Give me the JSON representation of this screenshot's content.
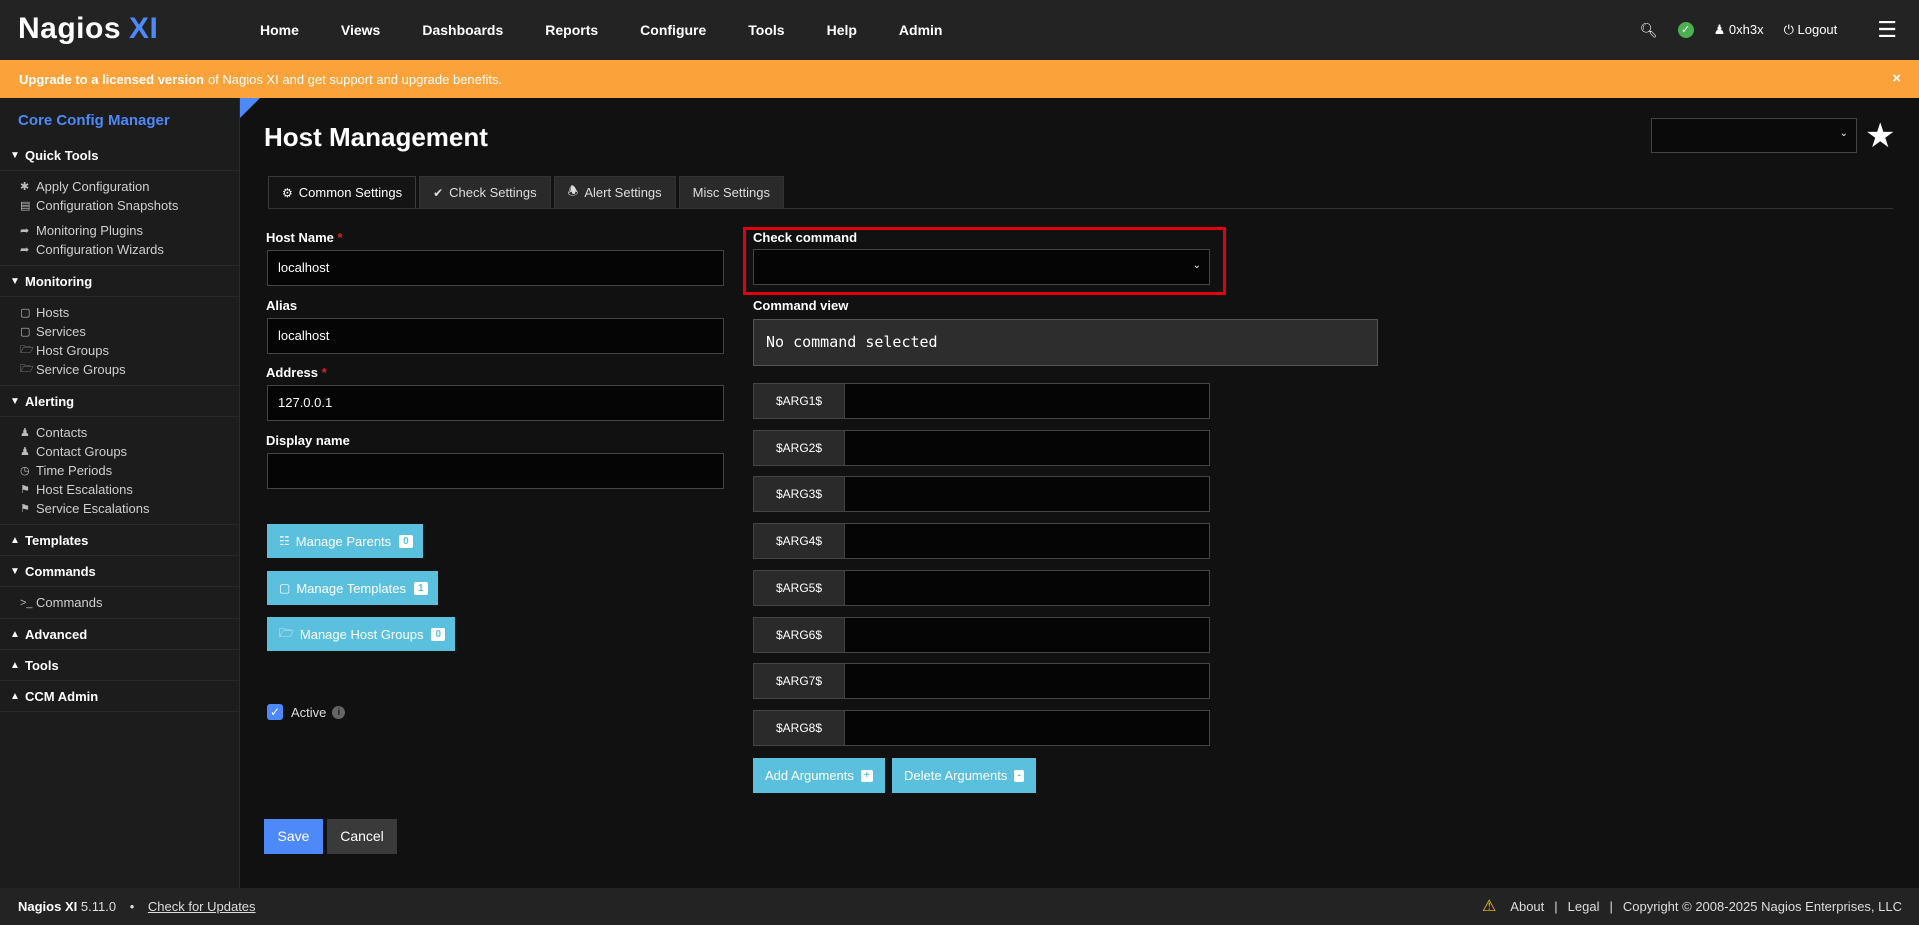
{
  "brand": {
    "name": "Nagios",
    "suffix": "XI"
  },
  "nav": [
    "Home",
    "Views",
    "Dashboards",
    "Reports",
    "Configure",
    "Tools",
    "Help",
    "Admin"
  ],
  "user": {
    "name": "0xh3x",
    "logout": "Logout"
  },
  "banner": {
    "bold": "Upgrade to a licensed version",
    "text": "of Nagios XI and get support and upgrade benefits.",
    "close": "×"
  },
  "sidebar": {
    "title": "Core Config Manager",
    "sections": {
      "quick_tools": {
        "label": "Quick Tools",
        "items": [
          "Apply Configuration",
          "Configuration Snapshots",
          "Monitoring Plugins",
          "Configuration Wizards"
        ]
      },
      "monitoring": {
        "label": "Monitoring",
        "items": [
          "Hosts",
          "Services",
          "Host Groups",
          "Service Groups"
        ]
      },
      "alerting": {
        "label": "Alerting",
        "items": [
          "Contacts",
          "Contact Groups",
          "Time Periods",
          "Host Escalations",
          "Service Escalations"
        ]
      },
      "templates": {
        "label": "Templates"
      },
      "commands": {
        "label": "Commands",
        "items": [
          "Commands"
        ]
      },
      "advanced": {
        "label": "Advanced"
      },
      "tools": {
        "label": "Tools"
      },
      "ccm_admin": {
        "label": "CCM Admin"
      }
    }
  },
  "page": {
    "title": "Host Management"
  },
  "tabs": [
    "Common Settings",
    "Check Settings",
    "Alert Settings",
    "Misc Settings"
  ],
  "form": {
    "host_name": {
      "label": "Host Name",
      "required": "*",
      "value": "localhost"
    },
    "alias": {
      "label": "Alias",
      "value": "localhost"
    },
    "address": {
      "label": "Address",
      "required": "*",
      "value": "127.0.0.1"
    },
    "display_name": {
      "label": "Display name",
      "value": ""
    },
    "manage_parents": {
      "label": "Manage Parents",
      "count": "0"
    },
    "manage_templates": {
      "label": "Manage Templates",
      "count": "1"
    },
    "manage_host_groups": {
      "label": "Manage Host Groups",
      "count": "0"
    },
    "active": {
      "label": "Active",
      "checked": true
    },
    "check_command": {
      "label": "Check command",
      "value": ""
    },
    "command_view": {
      "label": "Command view",
      "value": "No command selected"
    },
    "args": [
      "$ARG1$",
      "$ARG2$",
      "$ARG3$",
      "$ARG4$",
      "$ARG5$",
      "$ARG6$",
      "$ARG7$",
      "$ARG8$"
    ],
    "add_arguments": "Add Arguments",
    "delete_arguments": "Delete Arguments",
    "add_sign": "+",
    "delete_sign": "-",
    "save": "Save",
    "cancel": "Cancel"
  },
  "footer": {
    "product": "Nagios XI",
    "version": "5.11.0",
    "bullet": "•",
    "check_updates": "Check for Updates",
    "about": "About",
    "legal": "Legal",
    "copyright": "Copyright © 2008-2025 Nagios Enterprises, LLC"
  },
  "colors": {
    "accent": "#4d89f9",
    "banner": "#fba33a",
    "info_button": "#5bc0de",
    "highlight": "#e0000f"
  }
}
